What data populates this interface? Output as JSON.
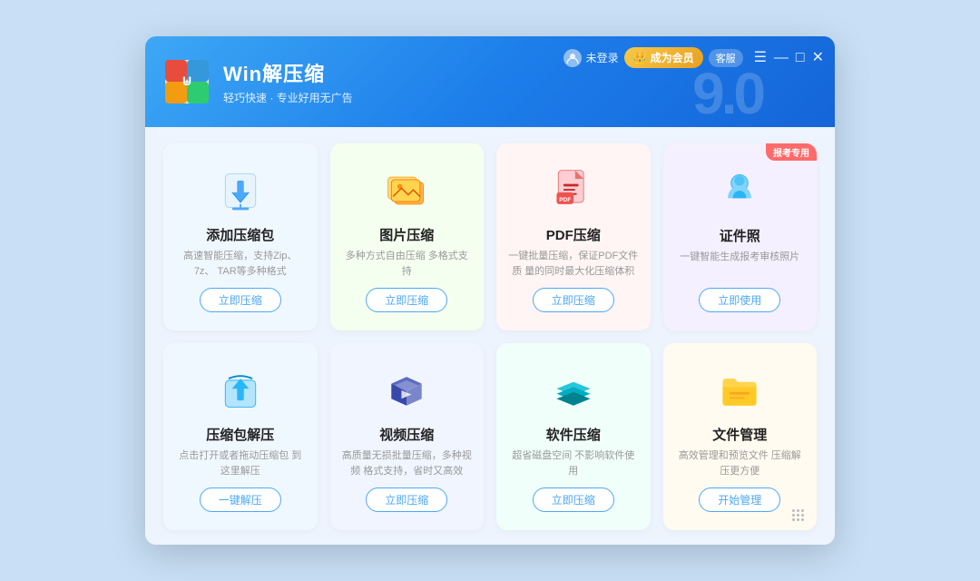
{
  "titlebar": {
    "app_name": "Win解压缩",
    "tagline": "轻巧快速 · 专业好用无广告",
    "version": "9.0",
    "login_label": "未登录",
    "vip_label": "成为会员",
    "guest_label": "客服",
    "menu_icon": "☰",
    "minimize_icon": "—",
    "maximize_icon": "□",
    "close_icon": "✕"
  },
  "cards": [
    {
      "id": "add-zip",
      "title": "添加压缩包",
      "desc": "高速智能压缩，支持Zip、7z、\nTAR等多种格式",
      "btn_label": "立即压缩",
      "bg_class": "card-zip",
      "badge": null
    },
    {
      "id": "image-compress",
      "title": "图片压缩",
      "desc": "多种方式自由压缩\n多格式支持",
      "btn_label": "立即压缩",
      "bg_class": "card-image",
      "badge": null
    },
    {
      "id": "pdf-compress",
      "title": "PDF压缩",
      "desc": "一键批量压缩，保证PDF文件质\n量的同时最大化压缩体积",
      "btn_label": "立即压缩",
      "bg_class": "card-pdf",
      "badge": null
    },
    {
      "id": "id-photo",
      "title": "证件照",
      "desc": "一键智能生成报考审核照片",
      "btn_label": "立即使用",
      "bg_class": "card-id",
      "badge": "报考专用"
    },
    {
      "id": "extract",
      "title": "压缩包解压",
      "desc": "点击打开或者拖动压缩包\n到这里解压",
      "btn_label": "一键解压",
      "bg_class": "card-extract",
      "badge": null
    },
    {
      "id": "video-compress",
      "title": "视频压缩",
      "desc": "高质量无损批量压缩，多种视频\n格式支持，省时又高效",
      "btn_label": "立即压缩",
      "bg_class": "card-video",
      "badge": null
    },
    {
      "id": "software-compress",
      "title": "软件压缩",
      "desc": "超省磁盘空间\n不影响软件使用",
      "btn_label": "立即压缩",
      "bg_class": "card-software",
      "badge": null
    },
    {
      "id": "file-manage",
      "title": "文件管理",
      "desc": "高效管理和预览文件\n压缩解压更方便",
      "btn_label": "开始管理",
      "bg_class": "card-filemanage",
      "badge": null
    }
  ],
  "icons": {
    "add-zip": "download-box",
    "image-compress": "image-stack",
    "pdf-compress": "pdf-doc",
    "id-photo": "person-card",
    "extract": "upload-box",
    "video-compress": "video-box",
    "software-compress": "layers",
    "file-manage": "folder"
  }
}
